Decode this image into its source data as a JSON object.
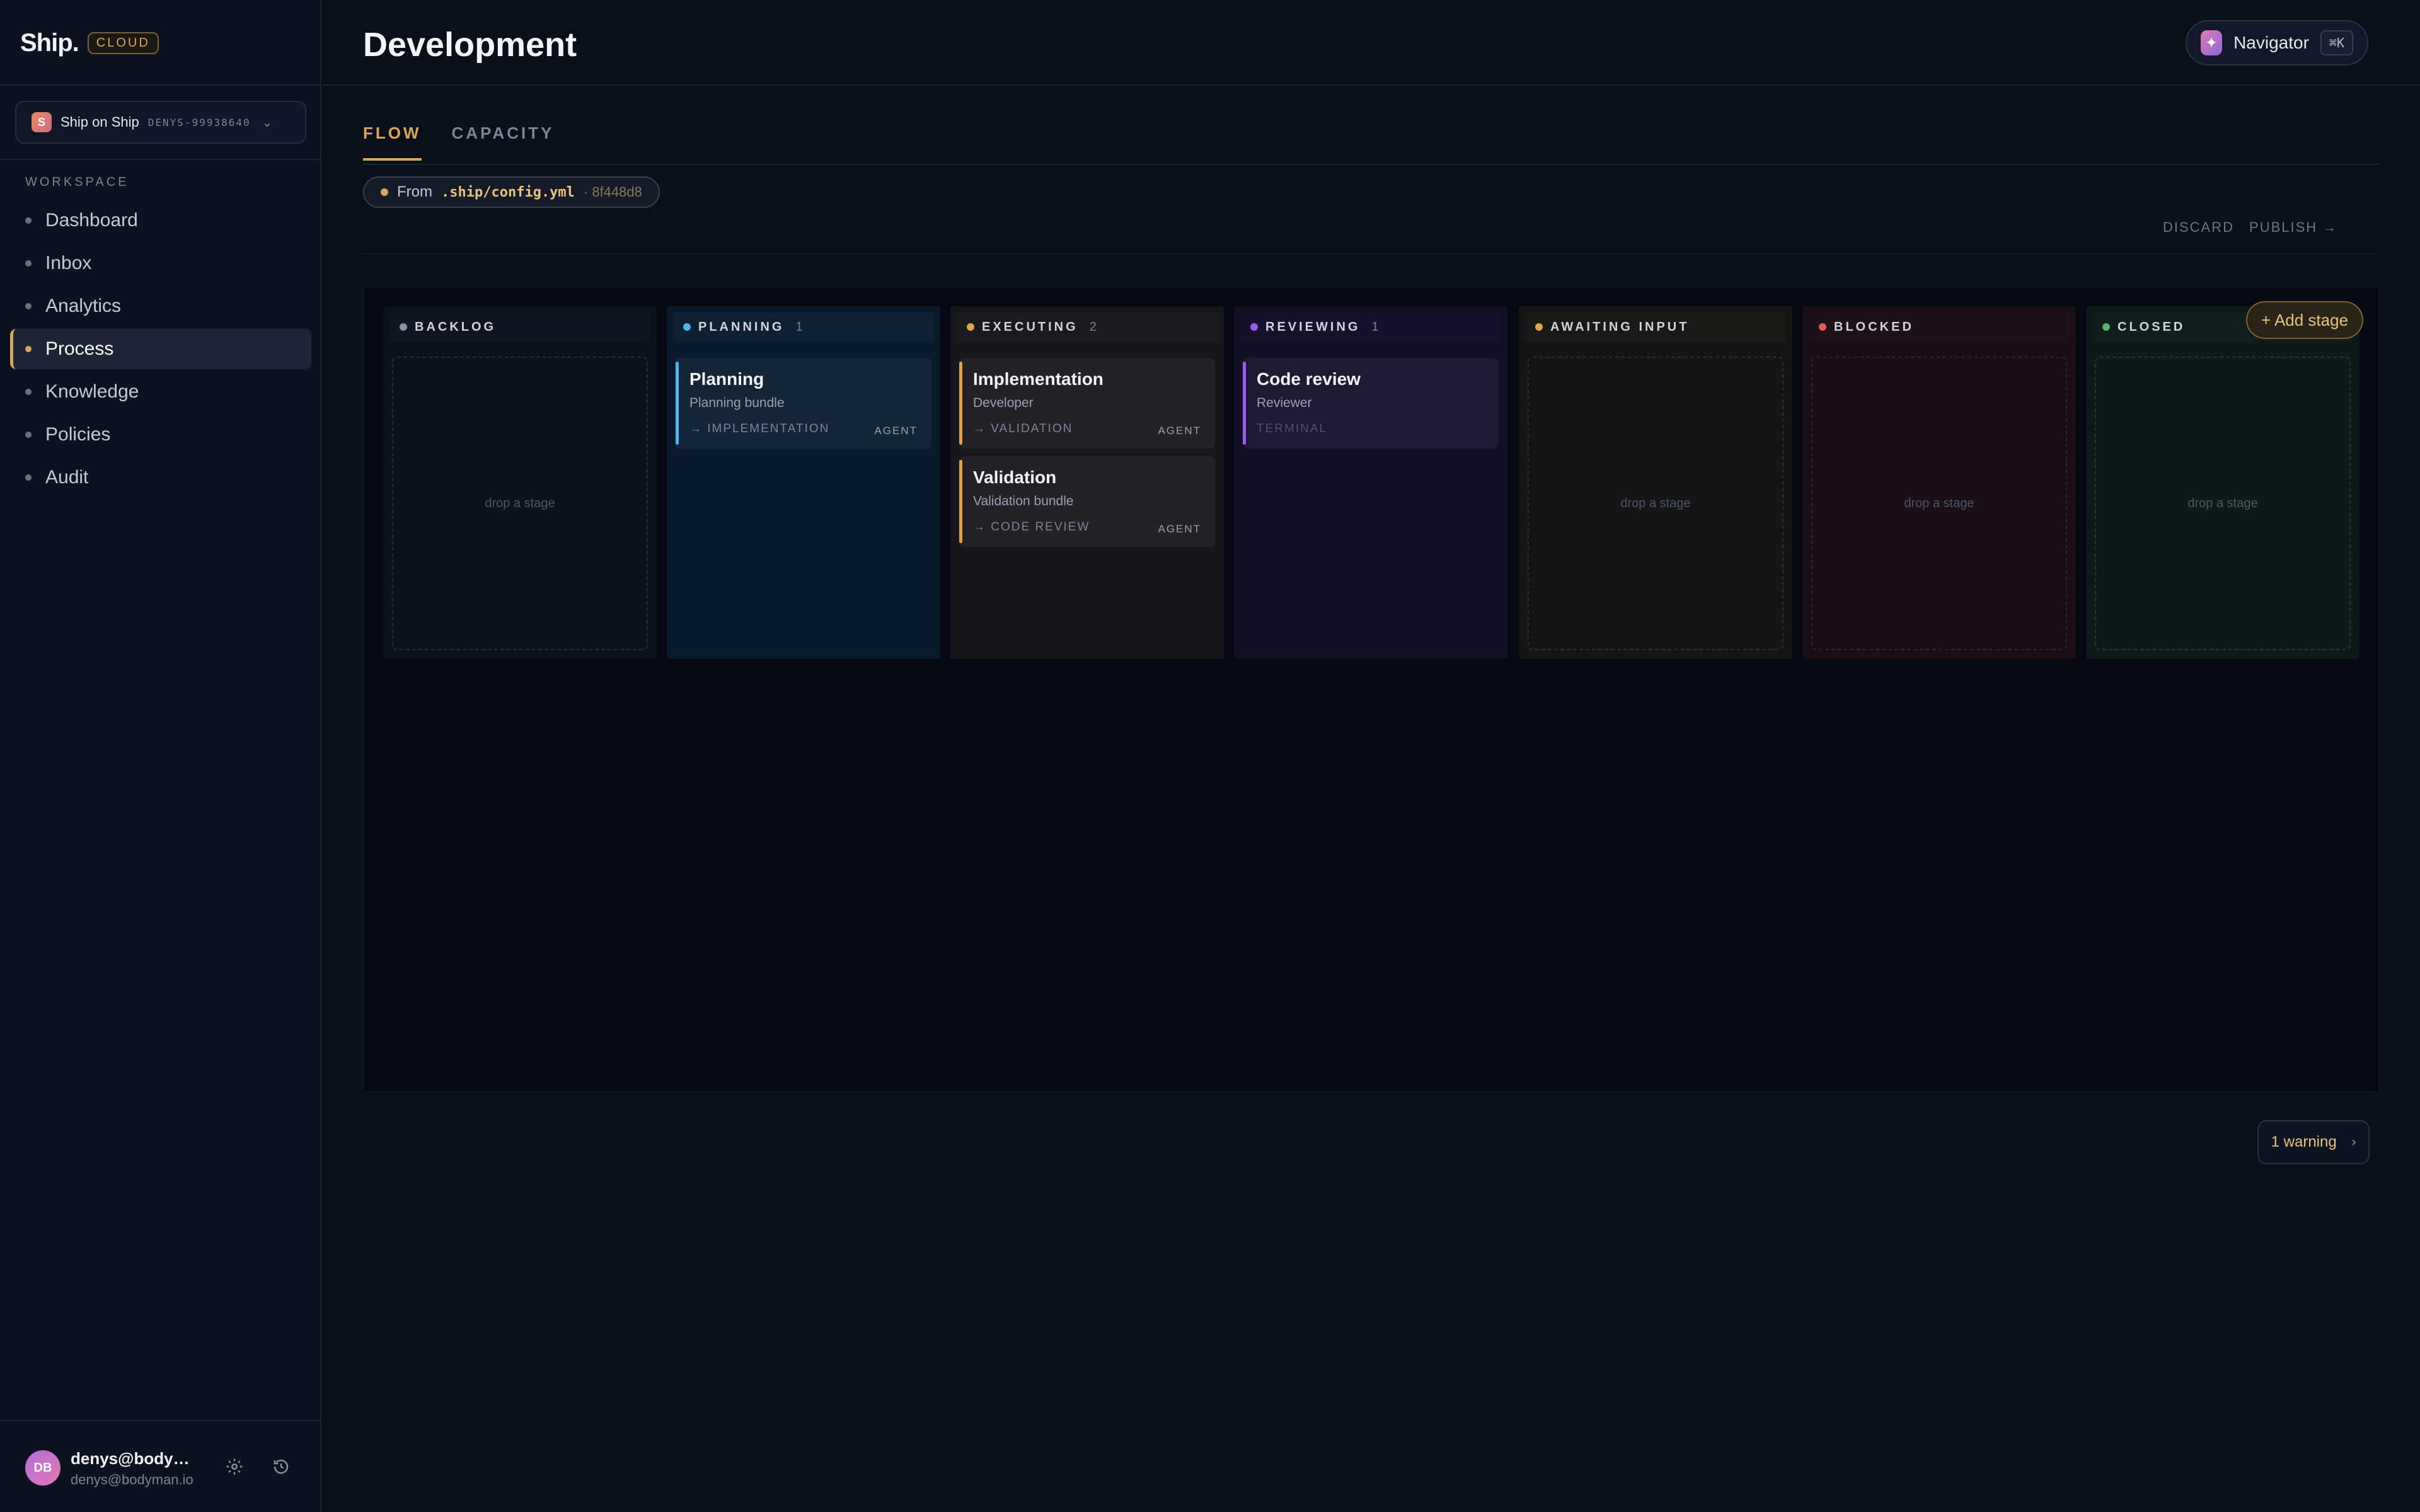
{
  "brand": {
    "name": "Ship.",
    "badge": "CLOUD"
  },
  "org": {
    "avatar": "S",
    "name": "Ship on Ship",
    "id": "DENYS-99938640",
    "chevron": "⌄"
  },
  "sidebar": {
    "section_label": "WORKSPACE",
    "items": [
      {
        "label": "Dashboard",
        "active": false
      },
      {
        "label": "Inbox",
        "active": false
      },
      {
        "label": "Analytics",
        "active": false
      },
      {
        "label": "Process",
        "active": true
      },
      {
        "label": "Knowledge",
        "active": false
      },
      {
        "label": "Policies",
        "active": false
      },
      {
        "label": "Audit",
        "active": false
      }
    ]
  },
  "user": {
    "initials": "DB",
    "name": "denys@bodyma...",
    "email": "denys@bodyman.io",
    "settings_icon": "gear-icon",
    "history_icon": "history-icon"
  },
  "page": {
    "title": "Development"
  },
  "navigator": {
    "label": "Navigator",
    "shortcut": "⌘K",
    "icon": "sparkle-icon"
  },
  "tabs": [
    {
      "label": "FLOW",
      "active": true
    },
    {
      "label": "CAPACITY",
      "active": false
    }
  ],
  "config": {
    "prefix": "From",
    "path": ".ship/config.yml",
    "hash": "· 8f448d8"
  },
  "actions": {
    "discard": "DISCARD",
    "publish": "PUBLISH →"
  },
  "board": {
    "add_stage": "+ Add stage",
    "columns": [
      {
        "label": "BACKLOG",
        "count": "",
        "color": "#8a90a2",
        "bg": "#0e121c",
        "header_bg": "#111522",
        "empty_text": "drop a stage",
        "border": "#252a37"
      },
      {
        "label": "PLANNING",
        "count": "1",
        "color": "#4fb3f0",
        "bg": "#0a1a2a",
        "header_bg": "#0e1f30",
        "empty_text": "",
        "border": "#1a2a3a"
      },
      {
        "label": "EXECUTING",
        "count": "2",
        "color": "#e2a445",
        "bg": "#17161a",
        "header_bg": "#1b1a1f",
        "empty_text": "",
        "border": "#262529"
      },
      {
        "label": "REVIEWING",
        "count": "1",
        "color": "#9a5cf0",
        "bg": "#130f24",
        "header_bg": "#17122b",
        "empty_text": "",
        "border": "#221a36"
      },
      {
        "label": "AWAITING INPUT",
        "count": "",
        "color": "#e2a445",
        "bg": "#151515",
        "header_bg": "#191918",
        "empty_text": "drop a stage",
        "border": "#2e2c29"
      },
      {
        "label": "BLOCKED",
        "count": "",
        "color": "#e05a5a",
        "bg": "#1a0f17",
        "header_bg": "#1e1119",
        "empty_text": "drop a stage",
        "border": "#3a1e28"
      },
      {
        "label": "CLOSED",
        "count": "",
        "color": "#4fb56f",
        "bg": "#0e1a18",
        "header_bg": "#111d1b",
        "empty_text": "drop a stage",
        "border": "#1e3530"
      }
    ],
    "cards": [
      {
        "column": 1,
        "slot": 0,
        "title": "Planning",
        "subtitle": "Planning bundle",
        "next": "→ IMPLEMENTATION",
        "tag": "AGENT",
        "accent": "#4fb3f0",
        "bg": "#142536"
      },
      {
        "column": 2,
        "slot": 0,
        "title": "Implementation",
        "subtitle": "Developer",
        "next": "→ VALIDATION",
        "tag": "AGENT",
        "accent": "#e2a445",
        "bg": "#232327"
      },
      {
        "column": 2,
        "slot": 1,
        "title": "Validation",
        "subtitle": "Validation bundle",
        "next": "→ CODE REVIEW",
        "tag": "AGENT",
        "accent": "#e2a445",
        "bg": "#232327"
      },
      {
        "column": 3,
        "slot": 0,
        "title": "Code review",
        "subtitle": "Reviewer",
        "next": "TERMINAL",
        "tag": "",
        "accent": "#9a5cf0",
        "bg": "#1f1a33"
      }
    ]
  },
  "warnings": {
    "label": "1 warning",
    "chevron": "›"
  }
}
